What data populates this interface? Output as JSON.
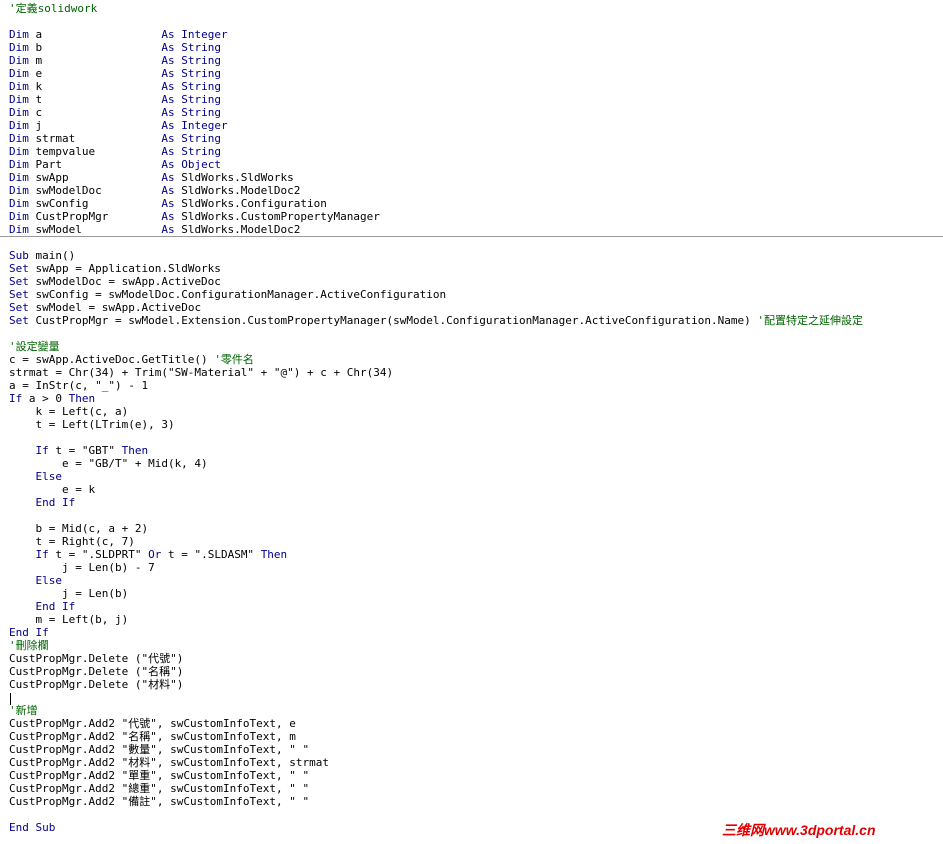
{
  "colors": {
    "background": "#ffffff",
    "keyword": "#00008b",
    "comment": "#006400",
    "text": "#000000",
    "separator": "#9a9a9a",
    "watermark": "#e40000"
  },
  "declarations": {
    "header_comment": "'定義solidwork",
    "lines": [
      [
        [
          "kw",
          "Dim"
        ],
        [
          "tx",
          " a                  "
        ],
        [
          "kw",
          "As"
        ],
        [
          "tx",
          " "
        ],
        [
          "kw",
          "Integer"
        ]
      ],
      [
        [
          "kw",
          "Dim"
        ],
        [
          "tx",
          " b                  "
        ],
        [
          "kw",
          "As"
        ],
        [
          "tx",
          " "
        ],
        [
          "kw",
          "String"
        ]
      ],
      [
        [
          "kw",
          "Dim"
        ],
        [
          "tx",
          " m                  "
        ],
        [
          "kw",
          "As"
        ],
        [
          "tx",
          " "
        ],
        [
          "kw",
          "String"
        ]
      ],
      [
        [
          "kw",
          "Dim"
        ],
        [
          "tx",
          " e                  "
        ],
        [
          "kw",
          "As"
        ],
        [
          "tx",
          " "
        ],
        [
          "kw",
          "String"
        ]
      ],
      [
        [
          "kw",
          "Dim"
        ],
        [
          "tx",
          " k                  "
        ],
        [
          "kw",
          "As"
        ],
        [
          "tx",
          " "
        ],
        [
          "kw",
          "String"
        ]
      ],
      [
        [
          "kw",
          "Dim"
        ],
        [
          "tx",
          " t                  "
        ],
        [
          "kw",
          "As"
        ],
        [
          "tx",
          " "
        ],
        [
          "kw",
          "String"
        ]
      ],
      [
        [
          "kw",
          "Dim"
        ],
        [
          "tx",
          " c                  "
        ],
        [
          "kw",
          "As"
        ],
        [
          "tx",
          " "
        ],
        [
          "kw",
          "String"
        ]
      ],
      [
        [
          "kw",
          "Dim"
        ],
        [
          "tx",
          " j                  "
        ],
        [
          "kw",
          "As"
        ],
        [
          "tx",
          " "
        ],
        [
          "kw",
          "Integer"
        ]
      ],
      [
        [
          "kw",
          "Dim"
        ],
        [
          "tx",
          " strmat             "
        ],
        [
          "kw",
          "As"
        ],
        [
          "tx",
          " "
        ],
        [
          "kw",
          "String"
        ]
      ],
      [
        [
          "kw",
          "Dim"
        ],
        [
          "tx",
          " tempvalue          "
        ],
        [
          "kw",
          "As"
        ],
        [
          "tx",
          " "
        ],
        [
          "kw",
          "String"
        ]
      ],
      [
        [
          "kw",
          "Dim"
        ],
        [
          "tx",
          " Part               "
        ],
        [
          "kw",
          "As"
        ],
        [
          "tx",
          " "
        ],
        [
          "kw",
          "Object"
        ]
      ],
      [
        [
          "kw",
          "Dim"
        ],
        [
          "tx",
          " swApp              "
        ],
        [
          "kw",
          "As"
        ],
        [
          "tx",
          " SldWorks.SldWorks"
        ]
      ],
      [
        [
          "kw",
          "Dim"
        ],
        [
          "tx",
          " swModelDoc         "
        ],
        [
          "kw",
          "As"
        ],
        [
          "tx",
          " SldWorks.ModelDoc2"
        ]
      ],
      [
        [
          "kw",
          "Dim"
        ],
        [
          "tx",
          " swConfig           "
        ],
        [
          "kw",
          "As"
        ],
        [
          "tx",
          " SldWorks.Configuration"
        ]
      ],
      [
        [
          "kw",
          "Dim"
        ],
        [
          "tx",
          " CustPropMgr        "
        ],
        [
          "kw",
          "As"
        ],
        [
          "tx",
          " SldWorks.CustomPropertyManager"
        ]
      ],
      [
        [
          "kw",
          "Dim"
        ],
        [
          "tx",
          " swModel            "
        ],
        [
          "kw",
          "As"
        ],
        [
          "tx",
          " SldWorks.ModelDoc2"
        ]
      ]
    ]
  },
  "procedure": {
    "lines": [
      [
        [
          "kw",
          "Sub"
        ],
        [
          "tx",
          " main()"
        ]
      ],
      [
        [
          "kw",
          "Set"
        ],
        [
          "tx",
          " swApp = Application.SldWorks"
        ]
      ],
      [
        [
          "kw",
          "Set"
        ],
        [
          "tx",
          " swModelDoc = swApp.ActiveDoc"
        ]
      ],
      [
        [
          "kw",
          "Set"
        ],
        [
          "tx",
          " swConfig = swModelDoc.ConfigurationManager.ActiveConfiguration"
        ]
      ],
      [
        [
          "kw",
          "Set"
        ],
        [
          "tx",
          " swModel = swApp.ActiveDoc"
        ]
      ],
      [
        [
          "kw",
          "Set"
        ],
        [
          "tx",
          " CustPropMgr = swModel.Extension.CustomPropertyManager(swModel.ConfigurationManager.ActiveConfiguration.Name) "
        ],
        [
          "cm",
          "'配置特定之延伸設定"
        ]
      ],
      [],
      [
        [
          "cm",
          "'設定變量"
        ]
      ],
      [
        [
          "tx",
          "c = swApp.ActiveDoc.GetTitle() "
        ],
        [
          "cm",
          "'零件名"
        ]
      ],
      [
        [
          "tx",
          "strmat = Chr(34) + Trim(\"SW-Material\" + \"@\") + c + Chr(34)"
        ]
      ],
      [
        [
          "tx",
          "a = InStr(c, \"_\") - 1"
        ]
      ],
      [
        [
          "kw",
          "If"
        ],
        [
          "tx",
          " a > 0 "
        ],
        [
          "kw",
          "Then"
        ]
      ],
      [
        [
          "tx",
          "    k = Left(c, a)"
        ]
      ],
      [
        [
          "tx",
          "    t = Left(LTrim(e), 3)"
        ]
      ],
      [],
      [
        [
          "tx",
          "    "
        ],
        [
          "kw",
          "If"
        ],
        [
          "tx",
          " t = \"GBT\" "
        ],
        [
          "kw",
          "Then"
        ]
      ],
      [
        [
          "tx",
          "        e = \"GB/T\" + Mid(k, 4)"
        ]
      ],
      [
        [
          "tx",
          "    "
        ],
        [
          "kw",
          "Else"
        ]
      ],
      [
        [
          "tx",
          "        e = k"
        ]
      ],
      [
        [
          "tx",
          "    "
        ],
        [
          "kw",
          "End If"
        ]
      ],
      [],
      [
        [
          "tx",
          "    b = Mid(c, a + 2)"
        ]
      ],
      [
        [
          "tx",
          "    t = Right(c, 7)"
        ]
      ],
      [
        [
          "tx",
          "    "
        ],
        [
          "kw",
          "If"
        ],
        [
          "tx",
          " t = \".SLDPRT\" "
        ],
        [
          "kw",
          "Or"
        ],
        [
          "tx",
          " t = \".SLDASM\" "
        ],
        [
          "kw",
          "Then"
        ]
      ],
      [
        [
          "tx",
          "        j = Len(b) - 7"
        ]
      ],
      [
        [
          "tx",
          "    "
        ],
        [
          "kw",
          "Else"
        ]
      ],
      [
        [
          "tx",
          "        j = Len(b)"
        ]
      ],
      [
        [
          "tx",
          "    "
        ],
        [
          "kw",
          "End If"
        ]
      ],
      [
        [
          "tx",
          "    m = Left(b, j)"
        ]
      ],
      [
        [
          "kw",
          "End If"
        ]
      ],
      [
        [
          "cm",
          "'刪除欄"
        ]
      ],
      [
        [
          "tx",
          "CustPropMgr.Delete (\"代號\")"
        ]
      ],
      [
        [
          "tx",
          "CustPropMgr.Delete (\"名稱\")"
        ]
      ],
      [
        [
          "tx",
          "CustPropMgr.Delete (\"材料\")"
        ]
      ],
      [],
      [
        [
          "cm",
          "'新增"
        ]
      ],
      [
        [
          "tx",
          "CustPropMgr.Add2 \"代號\", swCustomInfoText, e"
        ]
      ],
      [
        [
          "tx",
          "CustPropMgr.Add2 \"名稱\", swCustomInfoText, m"
        ]
      ],
      [
        [
          "tx",
          "CustPropMgr.Add2 \"數量\", swCustomInfoText, \" \""
        ]
      ],
      [
        [
          "tx",
          "CustPropMgr.Add2 \"材料\", swCustomInfoText, strmat"
        ]
      ],
      [
        [
          "tx",
          "CustPropMgr.Add2 \"單重\", swCustomInfoText, \" \""
        ]
      ],
      [
        [
          "tx",
          "CustPropMgr.Add2 \"總重\", swCustomInfoText, \" \""
        ]
      ],
      [
        [
          "tx",
          "CustPropMgr.Add2 \"備註\", swCustomInfoText, \" \""
        ]
      ],
      [],
      [
        [
          "kw",
          "End Sub"
        ]
      ]
    ]
  },
  "watermark": {
    "text": "三维网www.3dportal.cn"
  }
}
